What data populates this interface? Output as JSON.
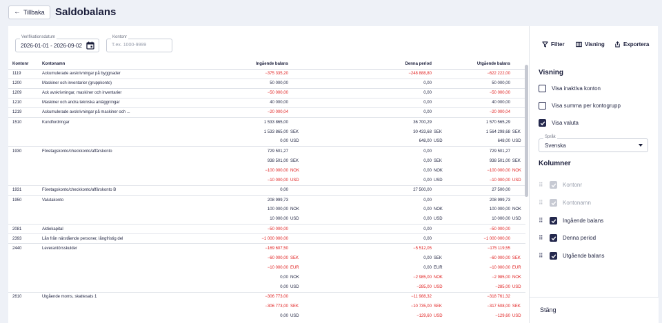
{
  "header": {
    "back_label": "Tillbaka",
    "title": "Saldobalans"
  },
  "filters": {
    "period": {
      "label": "Verifikationsdatum",
      "value": "2026-01-01 - 2026-09-02"
    },
    "account": {
      "label": "Kontonr",
      "placeholder": "T.ex. 1000-9999"
    }
  },
  "actions": {
    "filter": "Filter",
    "view": "Visning",
    "export": "Exportera"
  },
  "table": {
    "headers": {
      "account": "Kontonr",
      "name": "Kontonamn",
      "opening": "Ingående balans",
      "period": "Denna period",
      "closing": "Utgående balans"
    },
    "rows": [
      {
        "no": "1119",
        "name": "Ackumulerade avskrivningar på byggnader",
        "ob": "−375 335,20",
        "obc": "",
        "dp": "−248 888,80",
        "dpc": "",
        "ub": "−622 222,00",
        "ubc": "",
        "end": true
      },
      {
        "no": "1200",
        "name": "Maskiner och inventarier (gruppkonto)",
        "ob": "50 000,00",
        "obc": "",
        "dp": "0,00",
        "dpc": "",
        "ub": "50 000,00",
        "ubc": "",
        "end": true
      },
      {
        "no": "1209",
        "name": "Ack avskrivningar, maskiner och inventarier",
        "ob": "−50 000,00",
        "obc": "",
        "dp": "0,00",
        "dpc": "",
        "ub": "−50 000,00",
        "ubc": "",
        "end": true
      },
      {
        "no": "1210",
        "name": "Maskiner och andra tekniska anläggningar",
        "ob": "40 000,00",
        "obc": "",
        "dp": "0,00",
        "dpc": "",
        "ub": "40 000,00",
        "ubc": "",
        "end": true
      },
      {
        "no": "1219",
        "name": "Ackumulerade avskrivningar på maskiner och ...",
        "ob": "−20 000,04",
        "obc": "",
        "dp": "0,00",
        "dpc": "",
        "ub": "−20 000,04",
        "ubc": "",
        "end": true
      },
      {
        "no": "1510",
        "name": "Kundfordringar",
        "ob": "1 533 865,00",
        "obc": "",
        "dp": "36 700,29",
        "dpc": "",
        "ub": "1 570 565,29",
        "ubc": "",
        "end": false
      },
      {
        "no": "",
        "name": "",
        "ob": "1 533 865,00",
        "obc": "SEK",
        "dp": "30 433,68",
        "dpc": "SEK",
        "ub": "1 564 298,68",
        "ubc": "SEK",
        "end": false
      },
      {
        "no": "",
        "name": "",
        "ob": "0,00",
        "obc": "USD",
        "dp": "648,00",
        "dpc": "USD",
        "ub": "648,00",
        "ubc": "USD",
        "end": true
      },
      {
        "no": "1930",
        "name": "Företagskonto/checkkonto/affärskonto",
        "ob": "729 501,27",
        "obc": "",
        "dp": "0,00",
        "dpc": "",
        "ub": "729 501,27",
        "ubc": "",
        "end": false
      },
      {
        "no": "",
        "name": "",
        "ob": "938 501,00",
        "obc": "SEK",
        "dp": "0,00",
        "dpc": "SEK",
        "ub": "938 501,00",
        "ubc": "SEK",
        "end": false
      },
      {
        "no": "",
        "name": "",
        "ob": "−100 000,00",
        "obc": "NOK",
        "dp": "0,00",
        "dpc": "NOK",
        "ub": "−100 000,00",
        "ubc": "NOK",
        "end": false
      },
      {
        "no": "",
        "name": "",
        "ob": "−10 000,00",
        "obc": "USD",
        "dp": "0,00",
        "dpc": "USD",
        "ub": "−10 000,00",
        "ubc": "USD",
        "end": true
      },
      {
        "no": "1931",
        "name": "Företagskonto/checkkonto/affärskonto B",
        "ob": "0,00",
        "obc": "",
        "dp": "27 500,00",
        "dpc": "",
        "ub": "27 500,00",
        "ubc": "",
        "end": true
      },
      {
        "no": "1950",
        "name": "Valutakonto",
        "ob": "208 999,73",
        "obc": "",
        "dp": "0,00",
        "dpc": "",
        "ub": "208 999,73",
        "ubc": "",
        "end": false
      },
      {
        "no": "",
        "name": "",
        "ob": "100 000,00",
        "obc": "NOK",
        "dp": "0,00",
        "dpc": "NOK",
        "ub": "100 000,00",
        "ubc": "NOK",
        "end": false
      },
      {
        "no": "",
        "name": "",
        "ob": "10 000,00",
        "obc": "USD",
        "dp": "0,00",
        "dpc": "USD",
        "ub": "10 000,00",
        "ubc": "USD",
        "end": true
      },
      {
        "no": "2081",
        "name": "Aktiekapital",
        "ob": "−50 000,00",
        "obc": "",
        "dp": "0,00",
        "dpc": "",
        "ub": "−50 000,00",
        "ubc": "",
        "end": true
      },
      {
        "no": "2393",
        "name": "Lån från närstående personer, långfristig del",
        "ob": "−1 000 000,00",
        "obc": "",
        "dp": "0,00",
        "dpc": "",
        "ub": "−1 000 000,00",
        "ubc": "",
        "end": true
      },
      {
        "no": "2440",
        "name": "Leverantörsskulder",
        "ob": "−169 607,50",
        "obc": "",
        "dp": "−5 512,05",
        "dpc": "",
        "ub": "−175 119,55",
        "ubc": "",
        "end": false
      },
      {
        "no": "",
        "name": "",
        "ob": "−60 000,00",
        "obc": "SEK",
        "dp": "0,00",
        "dpc": "SEK",
        "ub": "−60 000,00",
        "ubc": "SEK",
        "end": false
      },
      {
        "no": "",
        "name": "",
        "ob": "−10 000,00",
        "obc": "EUR",
        "dp": "0,00",
        "dpc": "EUR",
        "ub": "−10 000,00",
        "ubc": "EUR",
        "end": false
      },
      {
        "no": "",
        "name": "",
        "ob": "0,00",
        "obc": "NOK",
        "dp": "−2 985,00",
        "dpc": "NOK",
        "ub": "−2 985,00",
        "ubc": "NOK",
        "end": false
      },
      {
        "no": "",
        "name": "",
        "ob": "0,00",
        "obc": "USD",
        "dp": "−285,00",
        "dpc": "USD",
        "ub": "−285,00",
        "ubc": "USD",
        "end": true
      },
      {
        "no": "2610",
        "name": "Utgående moms, skattesats 1",
        "ob": "−306 773,00",
        "obc": "",
        "dp": "−11 988,32",
        "dpc": "",
        "ub": "−318 761,32",
        "ubc": "",
        "end": false
      },
      {
        "no": "",
        "name": "",
        "ob": "−306 773,00",
        "obc": "SEK",
        "dp": "−10 735,00",
        "dpc": "SEK",
        "ub": "−317 508,00",
        "ubc": "SEK",
        "end": false
      },
      {
        "no": "",
        "name": "",
        "ob": "0,00",
        "obc": "USD",
        "dp": "−129,60",
        "dpc": "USD",
        "ub": "−129,60",
        "ubc": "USD",
        "end": false
      }
    ]
  },
  "panel": {
    "view_title": "Visning",
    "options": [
      {
        "label": "Visa inaktiva konton",
        "checked": false
      },
      {
        "label": "Visa summa per kontogrupp",
        "checked": false
      },
      {
        "label": "Visa valuta",
        "checked": true
      }
    ],
    "language": {
      "label": "Språk",
      "value": "Svenska"
    },
    "columns_title": "Kolumner",
    "columns": [
      {
        "label": "Kontonr",
        "checked": true,
        "disabled": true
      },
      {
        "label": "Kontonamn",
        "checked": true,
        "disabled": true
      },
      {
        "label": "Ingående balans",
        "checked": true,
        "disabled": false
      },
      {
        "label": "Denna period",
        "checked": true,
        "disabled": false
      },
      {
        "label": "Utgående balans",
        "checked": true,
        "disabled": false
      }
    ],
    "close_label": "Stäng"
  },
  "colors": {
    "accent": "#24284d",
    "negative": "#e02020",
    "background": "#eef1f7"
  },
  "icons": {
    "back": "arrow-left-icon",
    "calendar": "calendar-icon",
    "filter": "filter-icon",
    "view": "columns-icon",
    "export": "export-icon",
    "drag": "drag-handle-icon",
    "check": "checkmark-icon"
  }
}
